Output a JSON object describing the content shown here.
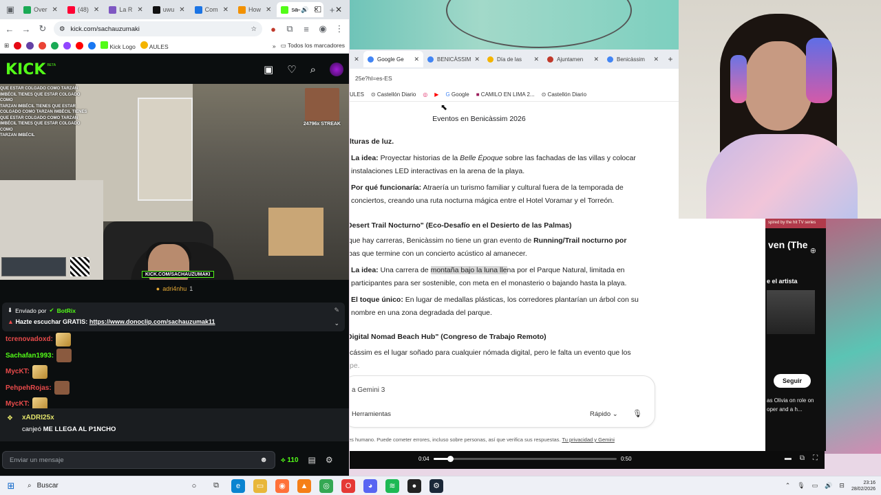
{
  "left_browser": {
    "tabs": [
      {
        "label": "Over",
        "color": "#1aaa55"
      },
      {
        "label": "(48)",
        "color": "#ff0033"
      },
      {
        "label": "La R",
        "color": "#7e57c2"
      },
      {
        "label": "uwu",
        "color": "#111111"
      },
      {
        "label": "Com",
        "color": "#1b74e4"
      },
      {
        "label": "How",
        "color": "#f29100"
      },
      {
        "label": "sa",
        "color": "#53fc18"
      }
    ],
    "url": "kick.com/sachauzumaki",
    "bookmarks": [
      "Kick Logo",
      "AULES"
    ],
    "all_bookmarks": "Todos los marcadores"
  },
  "kick": {
    "logo": "KICK",
    "beta": "BETA",
    "overlay_chat": [
      "QUE ESTAR COLGADO COMO TARZAN",
      "IMBÉCIL TIENES QUE ESTAR COLGADO COMO",
      "TARZAN IMBÉCIL TIENES QUE ESTAR",
      "COLGADO COMO TARZAN IMBÉCIL TIENES",
      "QUE ESTAR COLGADO COMO TARZAN",
      "IMBÉCIL TIENES QUE ESTAR COLGADO COMO",
      "TARZAN IMBÉCIL"
    ],
    "streak": "24796x STREAK",
    "watermark": "KICK.COM/SACHAUZUMAKI",
    "gifter_name": "adri4nhu",
    "gifter_count": "1",
    "pinned": {
      "sent_by": "Enviado por",
      "bot": "BotRix",
      "text": "Hazte escuchar GRATIS:",
      "link": "https://www.donoclip.com/sachauzumak11"
    },
    "chat": [
      {
        "user": "tcrenovadoxd:",
        "color": "#e94b4b",
        "emote": "hands"
      },
      {
        "user": "Sachafan1993:",
        "color": "#53fc18",
        "emote": "face"
      },
      {
        "user": "MycKT:",
        "color": "#e94b4b",
        "emote": "hands"
      },
      {
        "user": "PehpehRojas:",
        "color": "#e94b4b",
        "emote": "face"
      },
      {
        "user": "MycKT:",
        "color": "#e94b4b",
        "emote": "hands"
      }
    ],
    "redeem": {
      "user": "xADRI25x",
      "action": "canjeó",
      "reward": "ME LLEGA AL P1NCHO"
    },
    "input_placeholder": "Enviar un mensaje",
    "points": "110"
  },
  "right_browser": {
    "tabs": [
      {
        "label": "Google Ge",
        "color": "#4285f4"
      },
      {
        "label": "BENICÀSSIM",
        "color": "#4285f4"
      },
      {
        "label": "Día de las",
        "color": "#f4b400"
      },
      {
        "label": "Ajuntamen",
        "color": "#c0392b"
      },
      {
        "label": "Benicàssim",
        "color": "#4285f4"
      }
    ],
    "url": "25e?hl=es-ES",
    "bookmarks": [
      "ULES",
      "Castellón Diario",
      "Google",
      "CAMILO EN LIMA 2...",
      "Castellón Diario"
    ]
  },
  "gemini": {
    "title": "Eventos en Benicàssim 2026",
    "heading1_tail": "lturas de luz.",
    "idea1_label": "La idea:",
    "idea1_a": "Proyectar historias de la",
    "idea1_italic": "Belle Époque",
    "idea1_b": "sobre las fachadas de las villas y colocar",
    "idea1_c": "instalaciones LED interactivas en la arena de la playa.",
    "why_label": "Por qué funcionaría:",
    "why_a": "Atraería un turismo familiar y cultural fuera de la temporada de",
    "why_b": "conciertos, creando una ruta nocturna mágica entre el Hotel Voramar y el Torreón.",
    "heading2": "Desert Trail Nocturno\" (Eco-Desafío en el Desierto de las Palmas)",
    "p2_a": "que hay carreras, Benicàssim no tiene un gran evento de",
    "p2_bold": "Running/Trail nocturno por",
    "p2_b": "bas",
    "p2_c": "que termine con un concierto acústico al amanecer.",
    "idea2_label": "La idea:",
    "idea2_a": "Una carrera de",
    "idea2_hl": "montaña bajo la luna lle",
    "idea2_b": "na por el Parque Natural, limitada en",
    "idea2_c": "participantes para ser sostenible, con meta en el monasterio o bajando hasta la playa.",
    "touch_label": "El toque único:",
    "touch_a": "En lugar de medallas plásticas, los corredores plantarían un árbol con su",
    "touch_b": "nombre en una zona degradada del parque.",
    "heading3": "Digital Nomad Beach Hub\" (Congreso de Trabajo Remoto)",
    "p3_a": "cássim es el lugar soñado para cualquier nómada digital, pero le falta un evento que los",
    "p3_b": "pe.",
    "input_placeholder": "a Gemini 3",
    "tools": "Herramientas",
    "mode": "Rápido",
    "disclaimer": "es humano. Puede cometer errores, incluso sobre personas, así que verifica sus respuestas.",
    "privacy": "Tu privacidad y Gemini"
  },
  "side_video": {
    "tag": "spired by the hit TV series",
    "title": "ven (The",
    "artist": "e el artista",
    "follow": "Seguir",
    "desc": "as Olivia on role on oper and a h..."
  },
  "video_controls": {
    "current": "0:04",
    "duration": "0:50",
    "progress_fraction": 0.09
  },
  "taskbar": {
    "search": "Buscar",
    "time": "23:16",
    "date": "28/02/2026"
  }
}
